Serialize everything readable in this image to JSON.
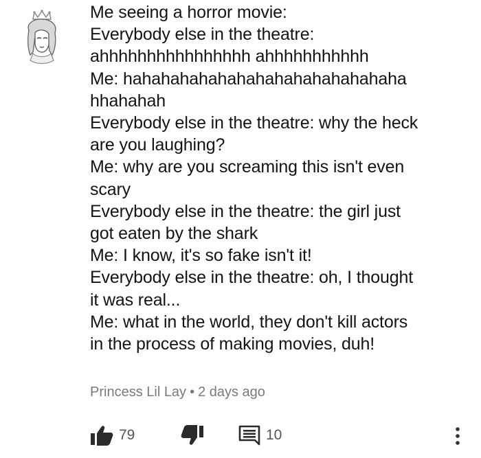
{
  "comment": {
    "lines": [
      "Me seeing a horror movie:",
      "Everybody else in the theatre:",
      "ahhhhhhhhhhhhhhhh ahhhhhhhhhhh",
      "Me: hahahahahahahahahahahahahahaha",
      "hhahahah",
      "Everybody else in the theatre: why the heck",
      "are you laughing?",
      "Me: why are you screaming this isn't even",
      "scary",
      "Everybody else in the theatre: the girl just",
      "got eaten by the shark",
      "Me: I know, it's so fake isn't it!",
      "Everybody else in the theatre: oh, I thought",
      "it was real...",
      "Me: what in the world, they don't kill actors",
      "in the process of making movies, duh!"
    ],
    "author": "Princess Lil Lay",
    "separator": "•",
    "time": "2 days ago"
  },
  "actions": {
    "like_count": "79",
    "reply_count": "10",
    "icons": {
      "like": "thumbs-up-icon",
      "dislike": "thumbs-down-icon",
      "reply": "comment-icon",
      "more": "more-vert-icon"
    }
  },
  "avatar": {
    "icon": "avatar-crown-girl-icon"
  }
}
